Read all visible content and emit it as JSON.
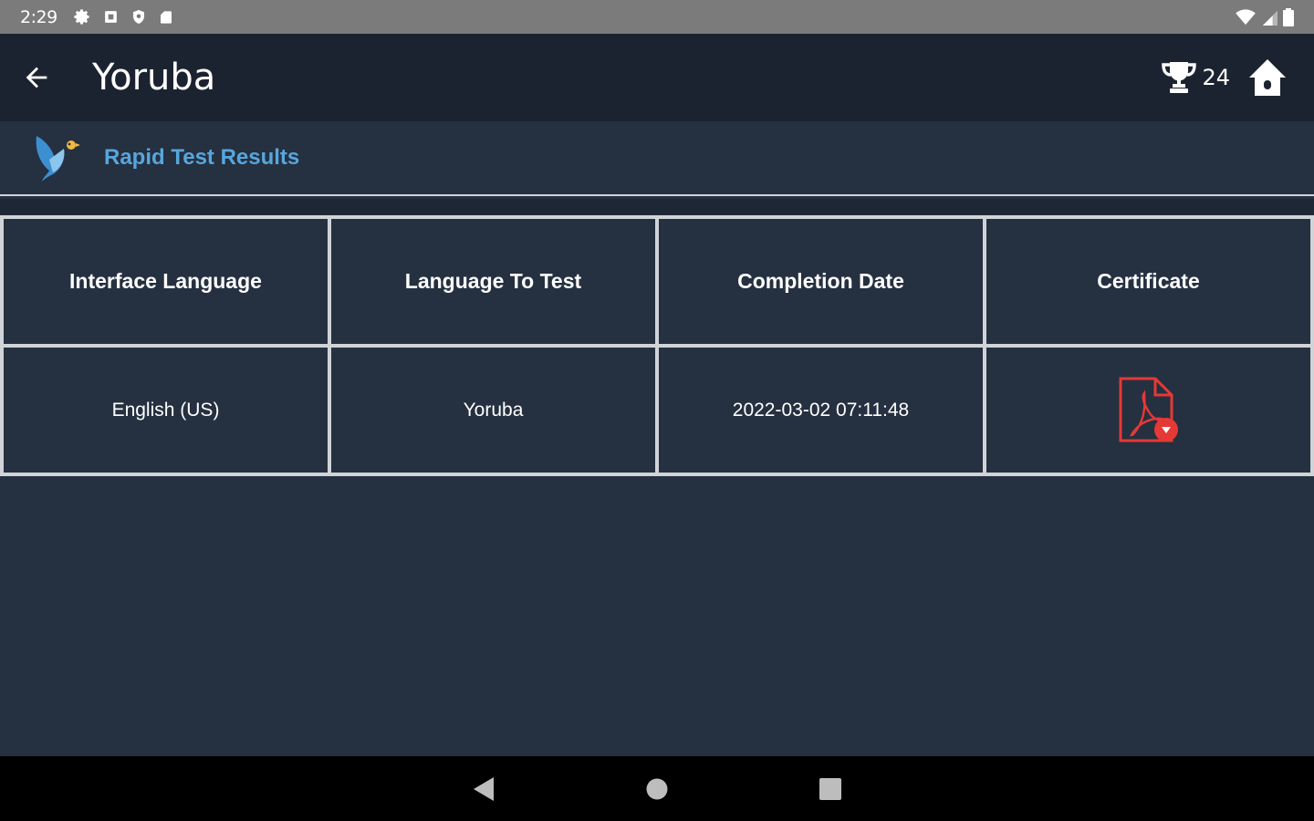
{
  "status_bar": {
    "time": "2:29",
    "icons": [
      "settings-icon",
      "app-icon",
      "shield-icon",
      "sd-card-icon"
    ],
    "right_icons": [
      "wifi-icon",
      "signal-icon",
      "battery-icon"
    ]
  },
  "app_bar": {
    "title": "Yoruba",
    "trophy_count": "24"
  },
  "section": {
    "title": "Rapid Test Results"
  },
  "table": {
    "headers": [
      "Interface Language",
      "Language To Test",
      "Completion Date",
      "Certificate"
    ],
    "rows": [
      {
        "interface_language": "English (US)",
        "language_to_test": "Yoruba",
        "completion_date": "2022-03-02 07:11:48",
        "certificate_icon": "pdf-download-icon"
      }
    ]
  },
  "colors": {
    "background": "#253040",
    "app_bar": "#1c2330",
    "accent": "#57a6dc",
    "pdf_red": "#e53935"
  }
}
